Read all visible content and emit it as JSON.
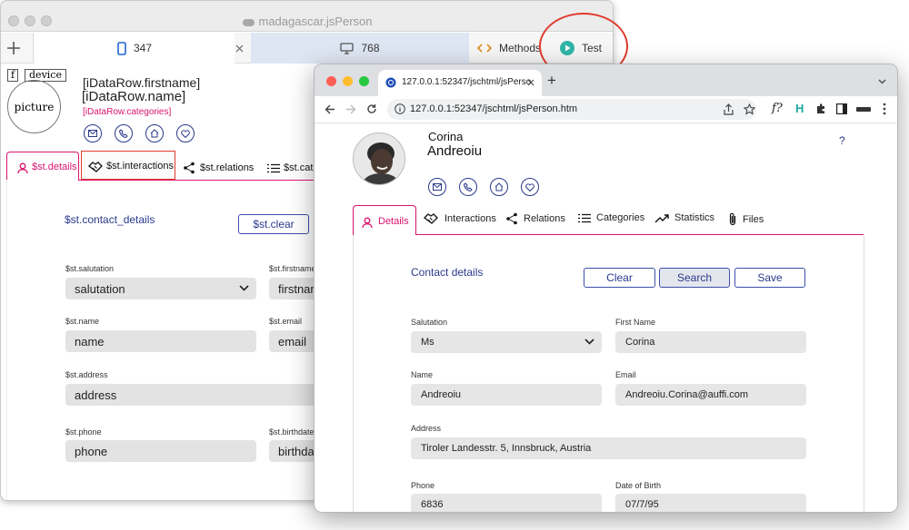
{
  "colors": {
    "accent": "#d9146e",
    "navy": "#2b3a8c",
    "annotation_circle": "#e03a2f",
    "test_icon": "#2fb5a8"
  },
  "back_window": {
    "title": "madagascar.jsPerson",
    "tabs": [
      {
        "label": "347",
        "icon": "phone-icon"
      },
      {
        "label": "768",
        "icon": "monitor-icon"
      },
      {
        "label": "Methods",
        "icon": "code-icon"
      },
      {
        "label": "Test",
        "icon": "play-icon"
      }
    ],
    "add_icon": "plus-icon",
    "close_icon": "close-icon",
    "f_button": "f",
    "device_button": "device",
    "picture_label": "picture",
    "firstname_placeholder": "[iDataRow.firstname]",
    "name_placeholder": "[iDataRow.name]",
    "categories_placeholder": "[iDataRow.categories]",
    "nav_tabs": [
      {
        "label": "$st.details",
        "icon": "user-icon"
      },
      {
        "label": "$st.interactions",
        "icon": "handshake-icon"
      },
      {
        "label": "$st.relations",
        "icon": "share-icon"
      },
      {
        "label": "$st.cate",
        "icon": "list-icon"
      }
    ],
    "section_title": "$st.contact_details",
    "clear_button": "$st.clear",
    "fields": {
      "salutation_label": "$st.salutation",
      "salutation_value": "salutation",
      "firstname_label": "$st.firstname",
      "firstname_value": "firstnam",
      "name_label": "$st.name",
      "name_value": "name",
      "email_label": "$st.email",
      "email_value": "email",
      "address_label": "$st.address",
      "address_value": "address",
      "phone_label": "$st.phone",
      "phone_value": "phone",
      "birthdate_label": "$st.birthdate",
      "birthdate_value": "birthdat"
    }
  },
  "browser": {
    "tab_title": "127.0.0.1:52347/jschtml/jsPerso",
    "url": "127.0.0.1:52347/jschtml/jsPerson.htm",
    "new_tab": "+",
    "ext_f": "f?",
    "ext_h": "H"
  },
  "person": {
    "firstname": "Corina",
    "lastname": "Andreoiu",
    "help": "?",
    "tabs": [
      {
        "label": "Details",
        "icon": "user-icon"
      },
      {
        "label": "Interactions",
        "icon": "handshake-icon"
      },
      {
        "label": "Relations",
        "icon": "share-icon"
      },
      {
        "label": "Categories",
        "icon": "list-icon"
      },
      {
        "label": "Statistics",
        "icon": "trend-icon"
      },
      {
        "label": "Files",
        "icon": "paperclip-icon"
      }
    ],
    "section_title": "Contact details",
    "buttons": {
      "clear": "Clear",
      "search": "Search",
      "save": "Save"
    },
    "fields": {
      "salutation_label": "Salutation",
      "salutation_value": "Ms",
      "firstname_label": "First Name",
      "firstname_value": "Corina",
      "name_label": "Name",
      "name_value": "Andreoiu",
      "email_label": "Email",
      "email_value": "Andreoiu.Corina@auffi.com",
      "address_label": "Address",
      "address_value": "Tiroler Landesstr. 5, Innsbruck, Austria",
      "phone_label": "Phone",
      "phone_value": "6836",
      "birthdate_label": "Date of Birth",
      "birthdate_value": "07/7/95"
    }
  }
}
